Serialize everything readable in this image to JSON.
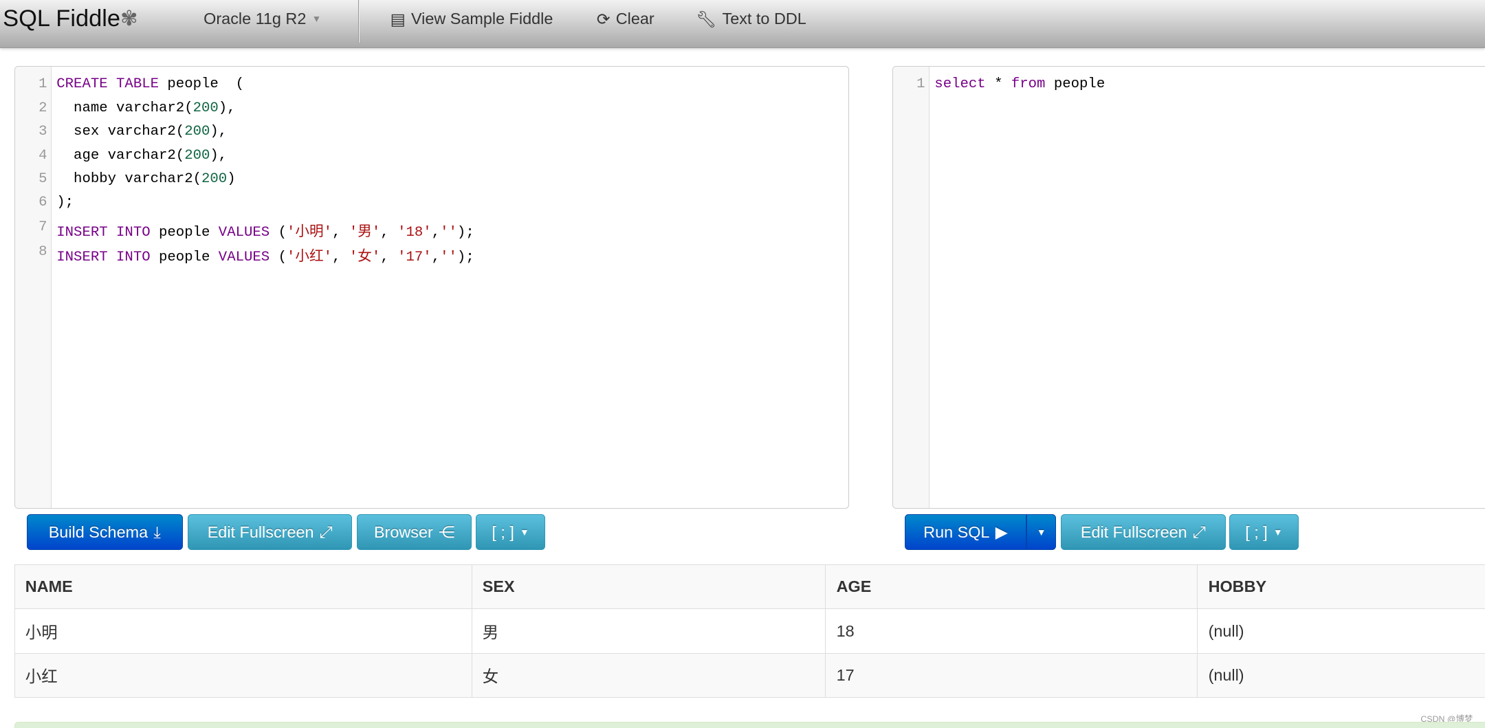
{
  "nav": {
    "brand": "SQL Fiddle",
    "db_select": "Oracle 11g R2",
    "view_sample": "View Sample Fiddle",
    "clear": "Clear",
    "text_to_ddl": "Text to DDL"
  },
  "schema_editor": {
    "lines": [
      "1",
      "2",
      "3",
      "4",
      "5",
      "6",
      "7",
      "8"
    ]
  },
  "schema_code": {
    "l1": {
      "k": "CREATE TABLE",
      "t": " people  ("
    },
    "l2": {
      "a": "  name varchar2(",
      "n": "200",
      "b": "),"
    },
    "l3": {
      "a": "  sex varchar2(",
      "n": "200",
      "b": "),"
    },
    "l4": {
      "a": "  age varchar2(",
      "n": "200",
      "b": "),"
    },
    "l5": {
      "a": "  hobby varchar2(",
      "n": "200",
      "b": ")"
    },
    "l6": ");",
    "l7": {
      "k1": "INSERT INTO",
      "t1": " people ",
      "k2": "VALUES",
      "t2": " (",
      "s1": "'小明'",
      "c1": ", ",
      "s2": "'男'",
      "c2": ", ",
      "s3": "'18'",
      "c3": ",",
      "s4": "''",
      "e": ");"
    },
    "l8": {
      "k1": "INSERT INTO",
      "t1": " people ",
      "k2": "VALUES",
      "t2": " (",
      "s1": "'小红'",
      "c1": ", ",
      "s2": "'女'",
      "c2": ", ",
      "s3": "'17'",
      "c3": ",",
      "s4": "''",
      "e": ");"
    }
  },
  "query_editor": {
    "line": "1",
    "k1": "select",
    "t1": " * ",
    "k2": "from",
    "t2": " people"
  },
  "schema_buttons": {
    "build": "Build Schema",
    "fullscreen": "Edit Fullscreen",
    "browser": "Browser",
    "delimiter": "[ ; ]"
  },
  "query_buttons": {
    "run": "Run SQL",
    "fullscreen": "Edit Fullscreen",
    "delimiter": "[ ; ]"
  },
  "results": {
    "columns": [
      "NAME",
      "SEX",
      "AGE",
      "HOBBY"
    ],
    "rows": [
      [
        "小明",
        "男",
        "18",
        "(null)"
      ],
      [
        "小红",
        "女",
        "17",
        "(null)"
      ]
    ]
  },
  "watermark": "CSDN @博梦",
  "colors": {
    "primary": "#0055cc",
    "info": "#49afcd",
    "keyword": "#770088",
    "number": "#116644",
    "string": "#aa1111"
  }
}
